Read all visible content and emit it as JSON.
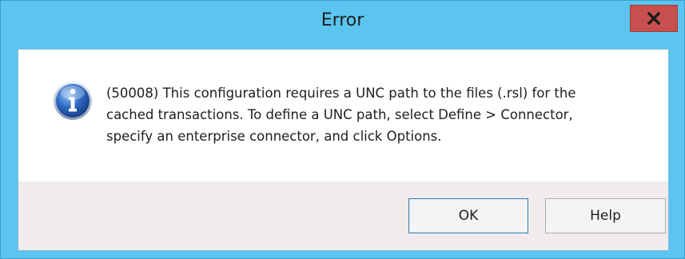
{
  "dialog": {
    "title": "Error",
    "close_symbol": "✖",
    "icon": "information-icon",
    "message": "(50008) This configuration requires a UNC path to the files (.rsl) for the\ncached transactions. To define a UNC path, select Define > Connector,\nspecify an enterprise connector, and click Options.",
    "buttons": {
      "ok": "OK",
      "help": "Help"
    }
  },
  "colors": {
    "frame": "#5bc5ef",
    "close_button": "#c7504e",
    "footer": "#f0ecec",
    "icon_blue": "#2a5fb5"
  }
}
